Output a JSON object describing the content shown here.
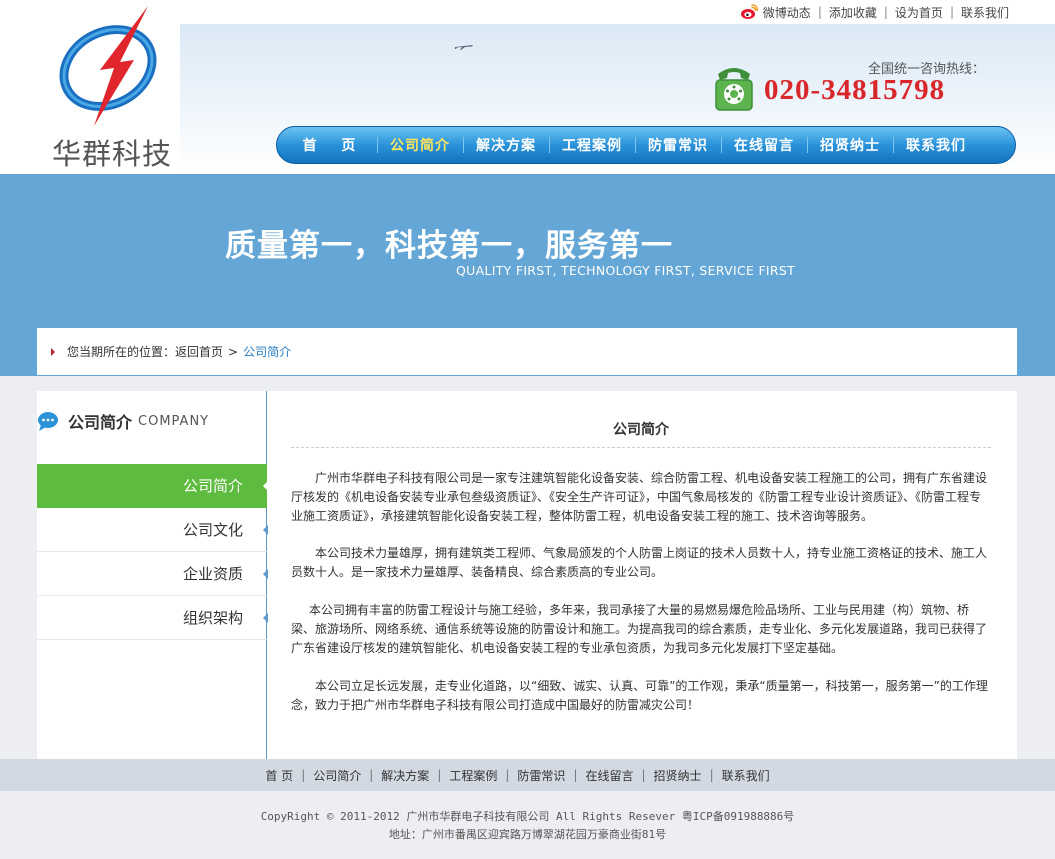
{
  "header": {
    "top_links": [
      "微博动态",
      "添加收藏",
      "设为首页",
      "联系我们"
    ],
    "logo_text": "华群科技",
    "hotline_label": "全国统一咨询热线：",
    "hotline_number": "020-34815798"
  },
  "nav": {
    "items": [
      "首 页",
      "公司简介",
      "解决方案",
      "工程案例",
      "防雷常识",
      "在线留言",
      "招贤纳士",
      "联系我们"
    ],
    "active_index": 1
  },
  "banner": {
    "slogan_zh": "质量第一，科技第一，服务第一",
    "slogan_en": "QUALITY FIRST, TECHNOLOGY FIRST, SERVICE FIRST"
  },
  "breadcrumb": {
    "label": "您当期所在的位置：",
    "home": "返回首页",
    "separator": ">",
    "current": "公司简介"
  },
  "sidebar": {
    "title_zh": "公司简介",
    "title_en": "COMPANY",
    "items": [
      "公司简介",
      "公司文化",
      "企业资质",
      "组织架构"
    ],
    "active_index": 0
  },
  "content": {
    "title": "公司简介",
    "paragraphs": [
      "广州市华群电子科技有限公司是一家专注建筑智能化设备安装、综合防雷工程、机电设备安装工程施工的公司，拥有广东省建设厅核发的《机电设备安装专业承包叁级资质证》、《安全生产许可证》，中国气象局核发的《防雷工程专业设计资质证》、《防雷工程专业施工资质证》，承接建筑智能化设备安装工程，整体防雷工程，机电设备安装工程的施工、技术咨询等服务。",
      "本公司技术力量雄厚，拥有建筑类工程师、气象局颁发的个人防雷上岗证的技术人员数十人，持专业施工资格证的技术、施工人员数十人。是一家技术力量雄厚、装备精良、综合素质高的专业公司。",
      "本公司拥有丰富的防雷工程设计与施工经验，多年来，我司承接了大量的易燃易爆危险品场所、工业与民用建（构）筑物、桥梁、旅游场所、网络系统、通信系统等设施的防雷设计和施工。为提高我司的综合素质，走专业化、多元化发展道路，我司已获得了广东省建设厅核发的建筑智能化、机电设备安装工程的专业承包资质，为我司多元化发展打下坚定基础。",
      "本公司立足长远发展，走专业化道路，以“细致、诚实、认真、可靠”的工作观，秉承“质量第一，科技第一，服务第一”的工作理念，致力于把广州市华群电子科技有限公司打造成中国最好的防雷减灾公司！"
    ]
  },
  "footer": {
    "nav_items": [
      "首 页",
      "公司简介",
      "解决方案",
      "工程案例",
      "防雷常识",
      "在线留言",
      "招贤纳士",
      "联系我们"
    ],
    "copyright": "CopyRight © 2011-2012 广州市华群电子科技有限公司 All Rights Resever 粤ICP备091988886号",
    "address": "地址：广州市番禺区迎宾路万博翠湖花园万豪商业街81号"
  },
  "colors": {
    "nav_blue": "#2a93da",
    "nav_active": "#ffe45a",
    "hotline_red": "#d9262a",
    "banner_blue": "#64a6d5",
    "sidebar_active_green": "#5dbb3f",
    "breadcrumb_current": "#2a7cc0"
  }
}
